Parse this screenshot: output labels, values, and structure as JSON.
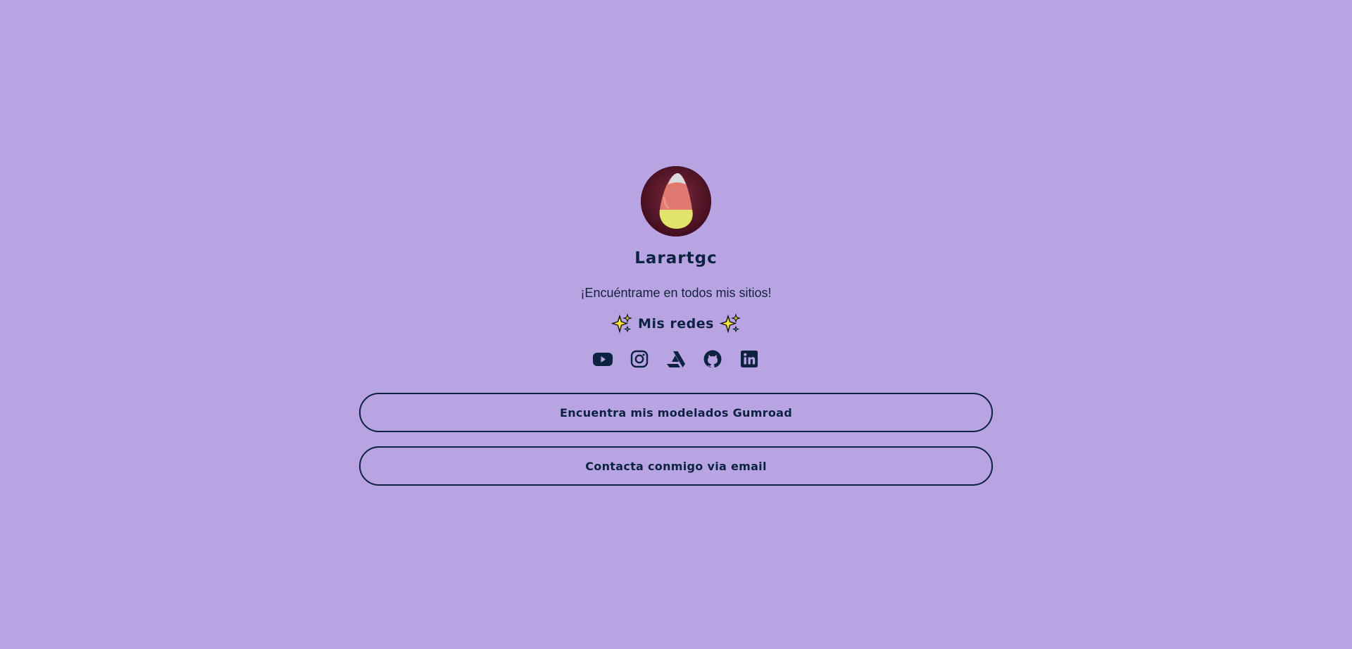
{
  "profile": {
    "name": "Larartgc",
    "bio": "¡Encuéntrame en todos mis sitios!",
    "avatar_icon": "candy-corn"
  },
  "socials_section": {
    "title": "Mis redes",
    "sparkle_icon": "sparkles-emoji",
    "items": [
      {
        "icon": "youtube-icon"
      },
      {
        "icon": "instagram-icon"
      },
      {
        "icon": "artstation-icon"
      },
      {
        "icon": "github-icon"
      },
      {
        "icon": "linkedin-icon"
      }
    ]
  },
  "links": [
    {
      "label": "Encuentra mis modelados Gumroad"
    },
    {
      "label": "Contacta conmigo via email"
    }
  ],
  "colors": {
    "background": "#b8a4e3",
    "text": "#0d2240",
    "button_border": "#0d2240"
  }
}
